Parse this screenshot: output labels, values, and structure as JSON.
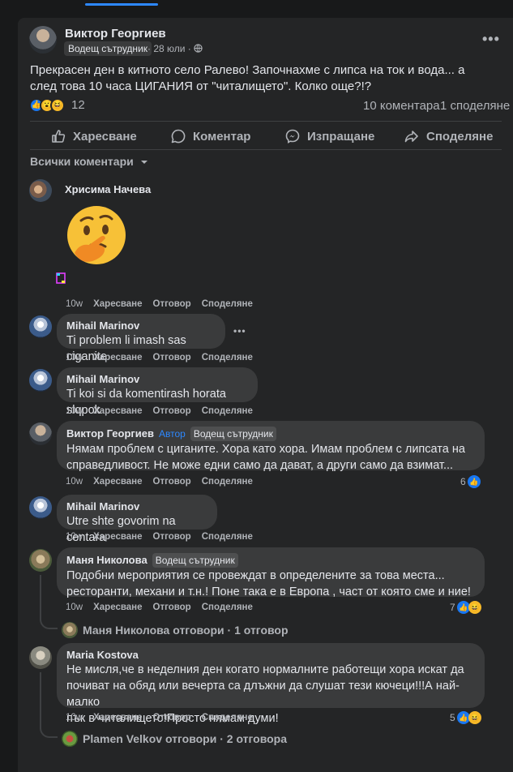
{
  "post": {
    "author": "Виктор Георгиев",
    "role": "Водещ сътрудник",
    "date": "28 юли",
    "privacy_glyph": "·",
    "text": "Прекрасен ден в китното село Ралево! Започнахме с липса на ток и вода... а след това 10 часа ЦИГАНИЯ от \"читалището\". Колко още?!?",
    "reaction_count": "12",
    "comment_count": "10 коментара",
    "share_count": "1 споделяне"
  },
  "actions": {
    "like": "Харесване",
    "comment": "Коментар",
    "send": "Изпращане",
    "share": "Споделяне"
  },
  "sort_label": "Всички коментари",
  "comment_actions": {
    "time": "10w",
    "like": "Харесване",
    "reply": "Отговор",
    "share": "Споделяне"
  },
  "comments": [
    {
      "name": "Хрисима Начева",
      "text": ""
    },
    {
      "name": "Mihail Marinov",
      "text": "Ti problem li imash sas ciganite"
    },
    {
      "name": "Mihail Marinov",
      "text": "Ti koi si da komentirash horata slqpok"
    },
    {
      "name": "Виктор Георгиев",
      "author_tag": "Автор",
      "role": "Водещ сътрудник",
      "text_line1": "Нямам проблем с циганите. Хора като хора. Имам проблем с липсата на",
      "text_line2": "справедливост. Не може едни само да дават, а други само да взимат...",
      "reactions": "6"
    },
    {
      "name": "Mihail Marinov",
      "text": "Utre shte govorim na centara"
    },
    {
      "name": "Маня Николова",
      "role": "Водещ сътрудник",
      "text_line1": "Подобни мероприятия се провеждат в определените за това места...",
      "text_line2": "ресторанти, механи и т.н.! Поне така е в Европа , част от която сме и ние!",
      "reactions": "7"
    },
    {
      "name": "Maria Kostova",
      "text_line1": "Не мисля,че в неделния ден когато нормалните работещи хора искат да",
      "text_line2": "почиват на обяд или вечерта са длъжни да слушат тези кючеци!!!А най-малко",
      "text_line3": "пък в читалището!Просто нямам думи!",
      "reactions": "5"
    }
  ],
  "replies": {
    "manya": "Маня Николова отговори · 1 отговор",
    "plamen": "Plamen Velkov отговори · 2 отговора"
  },
  "colors": {
    "accent": "#2d88ff",
    "card": "#242526",
    "bubble": "#3a3b3c"
  }
}
